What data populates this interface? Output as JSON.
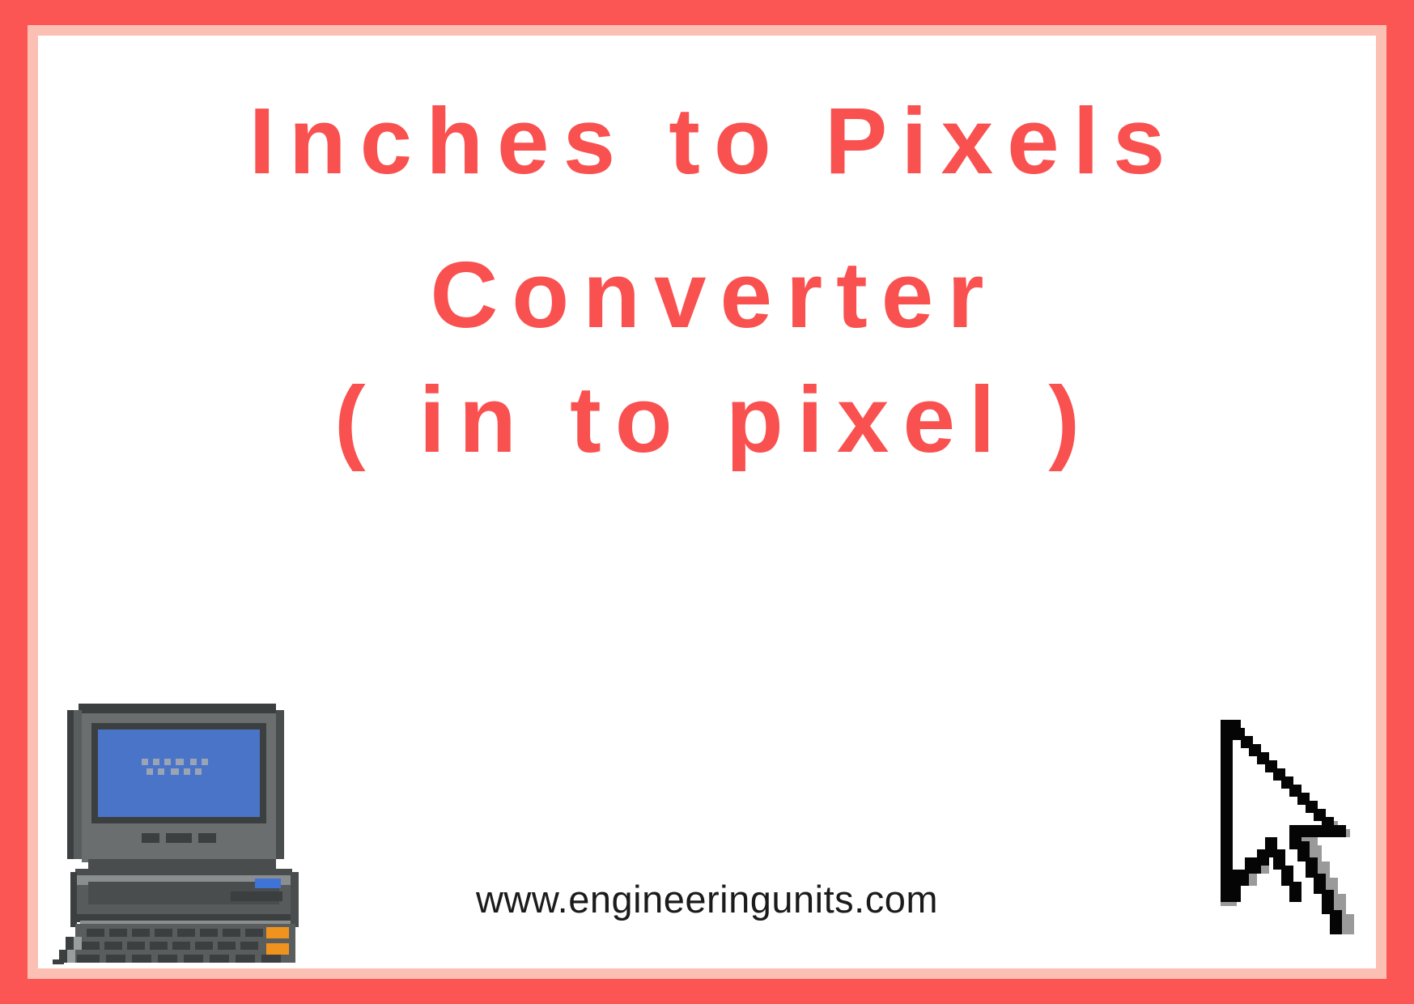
{
  "poster": {
    "title_lines": [
      "Inches to Pixels",
      "Converter",
      "( in to pixel )"
    ],
    "website": "www.engineeringunits.com",
    "colors": {
      "border_outer": "#fc5654",
      "border_inner": "#fbc0b3",
      "background": "#ffffff",
      "title_text": "#f9514f",
      "url_text": "#1b1b1b",
      "screen_blue": "#4a74c8",
      "case_grey": "#6b6e6e",
      "case_dark": "#3c3f40",
      "key_orange": "#f0931e",
      "cursor_black": "#050505",
      "cursor_shadow": "#9a9a9a"
    },
    "icons": {
      "computer": "retro-computer-icon",
      "cursor": "mouse-pointer-icon"
    }
  }
}
